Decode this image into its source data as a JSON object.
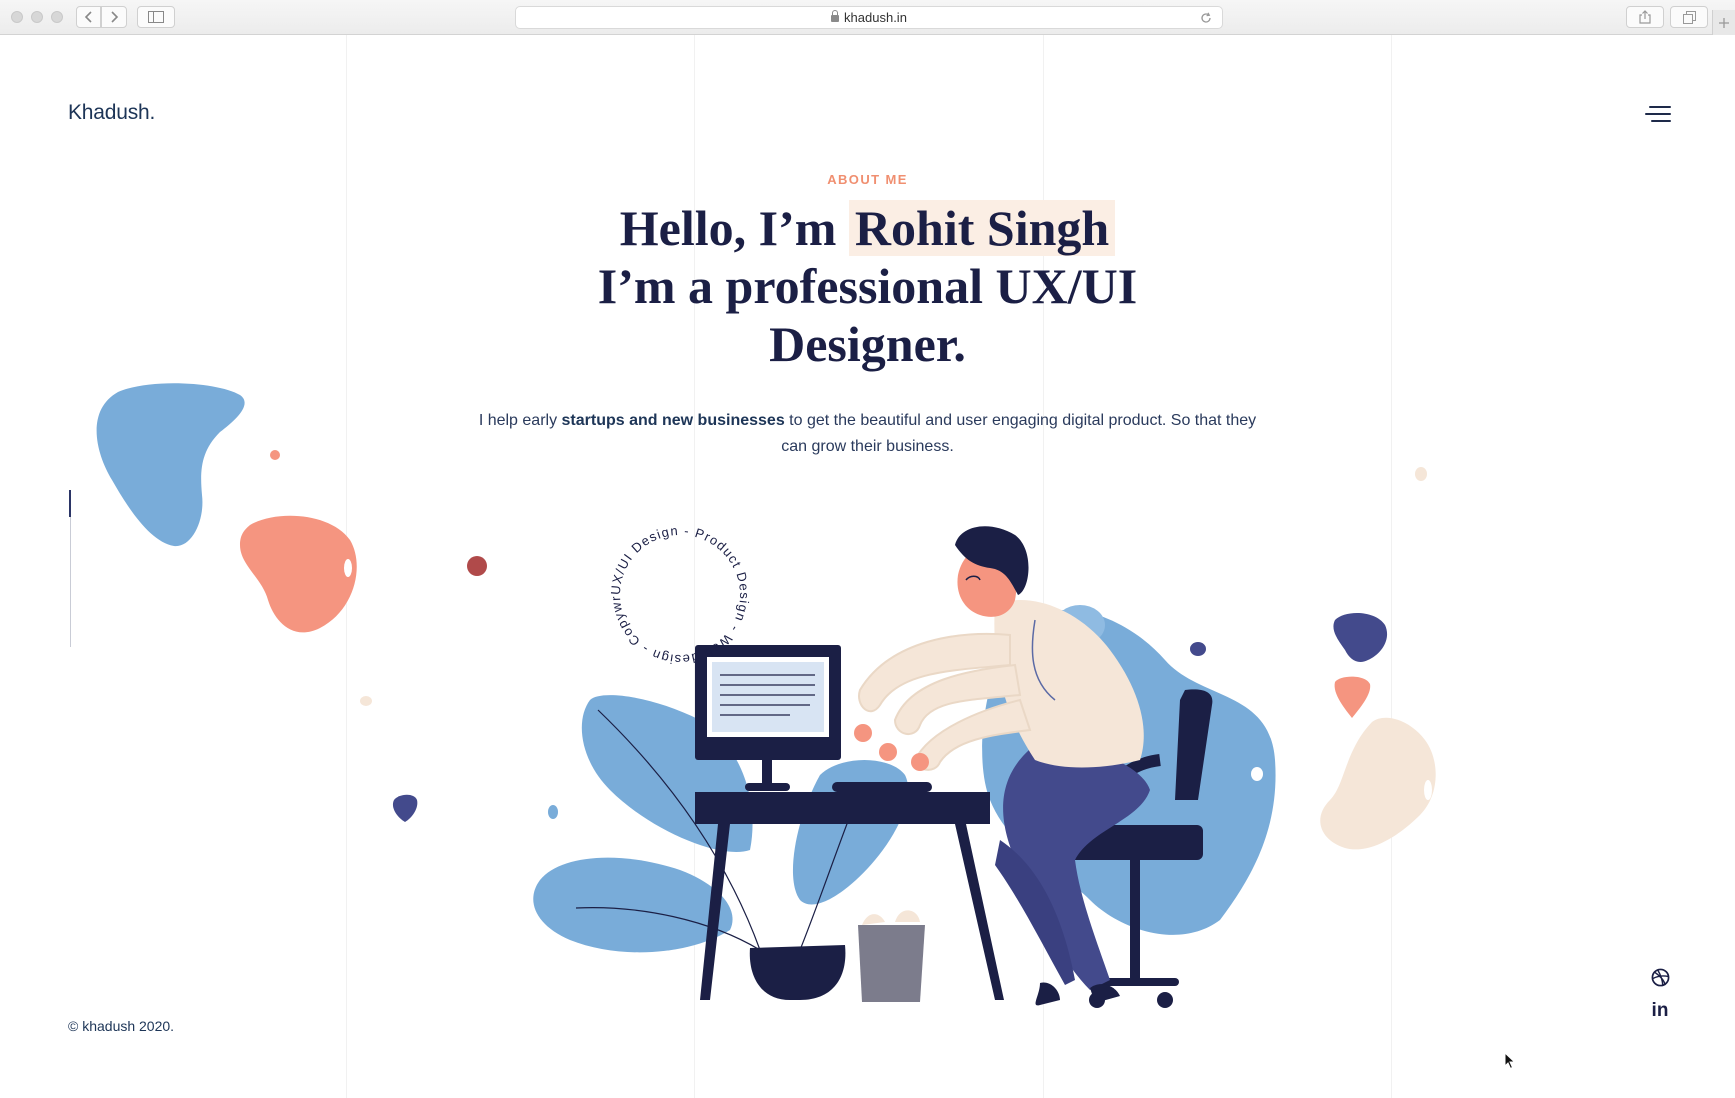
{
  "browser": {
    "url": "khadush.in"
  },
  "site": {
    "logo": "Khadush."
  },
  "hero": {
    "eyebrow": "ABOUT ME",
    "headline_line1_prefix": "Hello, I’m ",
    "headline_name": "Rohit Singh",
    "headline_line2": "I’m a professional UX/UI",
    "headline_line3": "Designer.",
    "intro_prefix": "I help early ",
    "intro_bold": "startups and new businesses",
    "intro_suffix": " to get the beautiful and user engaging digital product. So that they can grow their business."
  },
  "badge": {
    "circular_text": "UX/UI Design - Product Design - Web design - Copywriting - "
  },
  "footer": {
    "copyright": "© khadush 2020."
  },
  "social": {
    "icons": [
      "dribbble-icon",
      "linkedin-icon"
    ],
    "linkedin_glyph": "in"
  },
  "colors": {
    "navy": "#1b1f45",
    "accent": "#f08f70",
    "blue": "#79acd9",
    "salmon": "#f59580",
    "cream": "#f5e6d8"
  }
}
